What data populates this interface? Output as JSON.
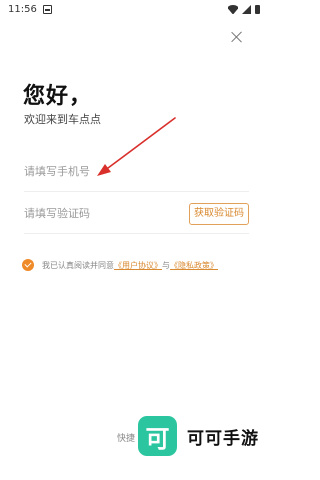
{
  "status_bar": {
    "time": "11:56",
    "icons": [
      "notification-icon",
      "wifi-icon",
      "cell-signal-icon",
      "battery-icon"
    ]
  },
  "header": {
    "close_icon": "close-icon",
    "greeting": "您好，",
    "welcome": "欢迎来到车点点"
  },
  "form": {
    "phone_placeholder": "请填写手机号",
    "phone_value": "",
    "code_placeholder": "请填写验证码",
    "code_value": "",
    "get_code_label": "获取验证码"
  },
  "agreement": {
    "checked": true,
    "prefix": "我已认真阅读并同意",
    "user_agreement": "《用户协议》",
    "connector": "与",
    "privacy_policy": "《隐私政策》"
  },
  "footer": {
    "quick_login_partial": "快捷"
  },
  "watermark": {
    "logo_char": "可",
    "name": "可可手游"
  },
  "colors": {
    "accent": "#ef8a28",
    "accent_text": "#d9892f",
    "annotation_arrow": "#d9302c",
    "watermark_green": "#2bc6a0"
  }
}
